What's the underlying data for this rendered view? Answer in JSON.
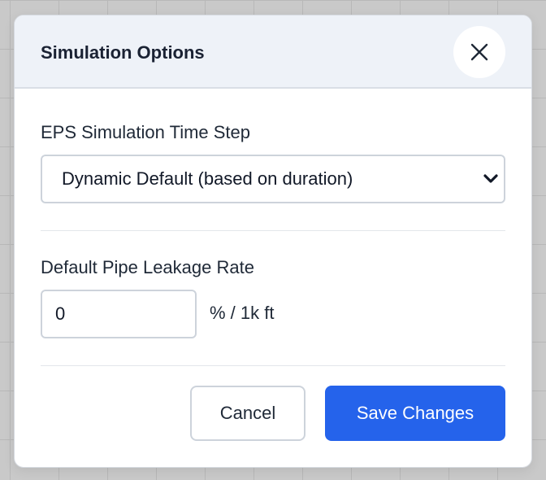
{
  "dialog": {
    "title": "Simulation Options",
    "close_icon": "close-icon"
  },
  "time_step": {
    "label": "EPS Simulation Time Step",
    "selected": "Dynamic Default (based on duration)",
    "chevron_icon": "chevron-down-icon"
  },
  "leakage": {
    "label": "Default Pipe Leakage Rate",
    "value": "0",
    "unit": "% / 1k ft"
  },
  "footer": {
    "cancel_label": "Cancel",
    "save_label": "Save Changes"
  },
  "colors": {
    "primary": "#2563eb",
    "header_bg": "#eef2f8",
    "backdrop": "#c9c9c9"
  }
}
